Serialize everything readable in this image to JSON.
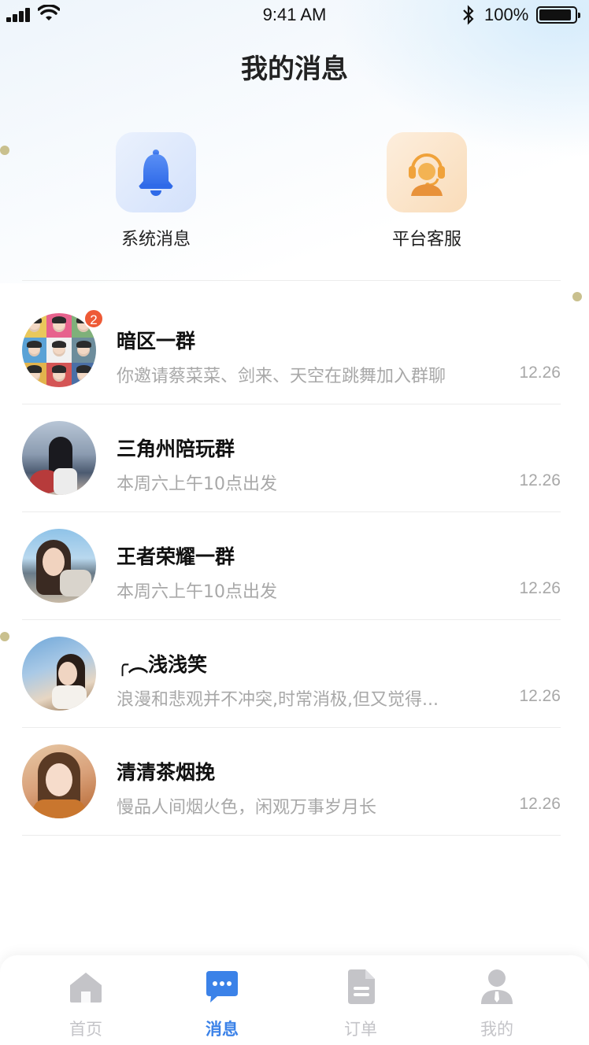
{
  "status_bar": {
    "time": "9:41 AM",
    "battery": "100%"
  },
  "header": {
    "title": "我的消息"
  },
  "quick_actions": [
    {
      "label": "系统消息",
      "icon": "bell-icon"
    },
    {
      "label": "平台客服",
      "icon": "customer-service-icon"
    }
  ],
  "chats": [
    {
      "name": "暗区一群",
      "preview": "你邀请蔡菜菜、剑来、天空在跳舞加入群聊",
      "time": "12.26",
      "badge": "2"
    },
    {
      "name": "三角州陪玩群",
      "preview": "本周六上午10点出发",
      "time": "12.26"
    },
    {
      "name": "王者荣耀一群",
      "preview": "本周六上午10点出发",
      "time": "12.26"
    },
    {
      "name": "╭︵浅浅笑",
      "preview": "浪漫和悲观并不冲突,时常消极,但又觉得...",
      "time": "12.26"
    },
    {
      "name": "清清茶烟挽",
      "preview": "慢品人间烟火色，闲观万事岁月长",
      "time": "12.26"
    }
  ],
  "tabbar": [
    {
      "label": "首页",
      "icon": "home-icon",
      "active": false
    },
    {
      "label": "消息",
      "icon": "message-icon",
      "active": true
    },
    {
      "label": "订单",
      "icon": "order-icon",
      "active": false
    },
    {
      "label": "我的",
      "icon": "profile-icon",
      "active": false
    }
  ],
  "colors": {
    "accent": "#3b82e8",
    "badge": "#ee5a36",
    "muted_text": "#a8a8a8",
    "tab_inactive": "#c4c4c8"
  }
}
